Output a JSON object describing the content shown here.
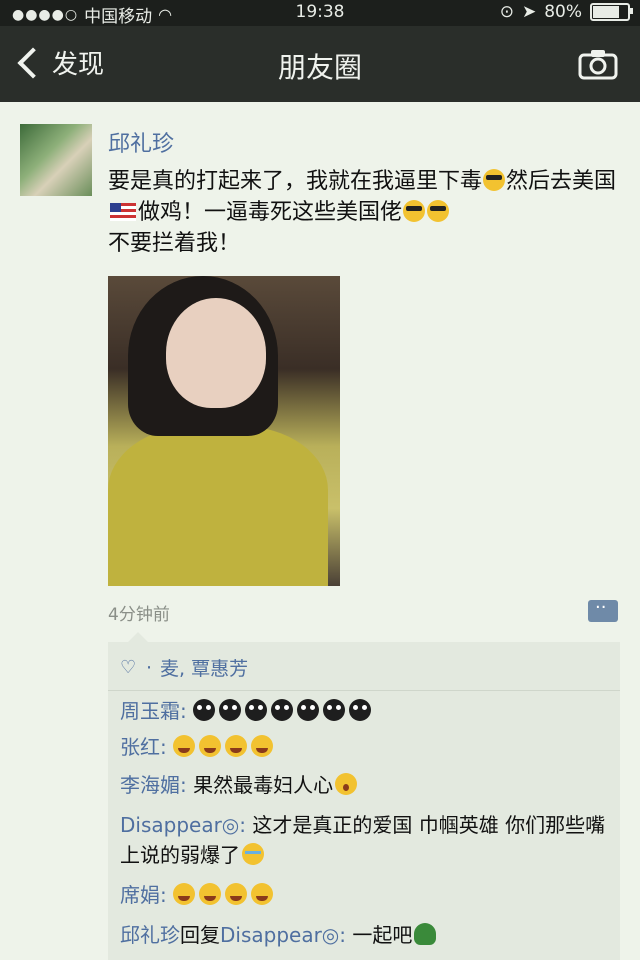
{
  "status_bar": {
    "carrier": "中国移动",
    "time": "19:38",
    "battery": "80%",
    "battery_level": 0.8
  },
  "nav": {
    "back_label": "发现",
    "title": "朋友圈"
  },
  "post": {
    "author": "邱礼珍",
    "text_part1": "要是真的打起来了，我就在我逼里下毒",
    "text_part2": "然后去美国",
    "text_part3": "做鸡！一逼毒死这些美国佬",
    "text_part4": "不要拦着我！",
    "timestamp": "4分钟前"
  },
  "likes": {
    "names": "麦, 覃惠芳"
  },
  "comments": [
    {
      "name": "周玉霜",
      "sep": ": ",
      "text": "",
      "emojis": [
        "devil",
        "devil",
        "devil",
        "devil",
        "devil",
        "devil",
        "devil"
      ]
    },
    {
      "name": "张红",
      "sep": ": ",
      "text": "",
      "emojis": [
        "laugh",
        "laugh",
        "laugh",
        "laugh"
      ]
    },
    {
      "name": "李海媚",
      "sep": ": ",
      "text": "果然最毒妇人心",
      "emojis": [
        "shock"
      ]
    },
    {
      "name": "Disappear◎",
      "sep": ": ",
      "text": "这才是真正的爱国 巾帼英雄 你们那些嘴上说的弱爆了",
      "emojis": [
        "cry"
      ]
    },
    {
      "name": "席娟",
      "sep": ": ",
      "text": "",
      "emojis": [
        "laugh",
        "laugh",
        "laugh",
        "laugh"
      ]
    },
    {
      "name": "邱礼珍",
      "reply_word": "回复",
      "reply_to": "Disappear◎",
      "sep": ": ",
      "text": "一起吧",
      "emojis": [
        "turtle"
      ]
    }
  ]
}
